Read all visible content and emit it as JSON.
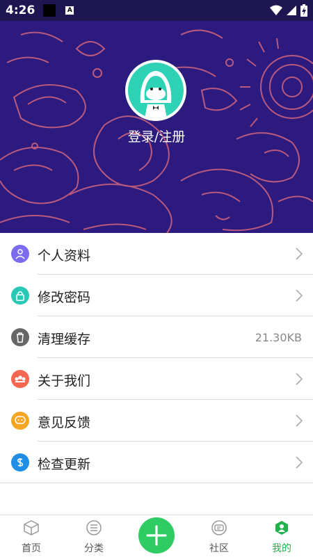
{
  "status_bar": {
    "time": "4:26",
    "notif_letter": "A"
  },
  "header": {
    "login_text": "登录/注册"
  },
  "menu": [
    {
      "label": "个人资料",
      "icon": "user-icon",
      "color": "#7b6cf0",
      "value": ""
    },
    {
      "label": "修改密码",
      "icon": "lock-icon",
      "color": "#29c9b5",
      "value": ""
    },
    {
      "label": "清理缓存",
      "icon": "trash-icon",
      "color": "#666666",
      "value": "21.30KB"
    },
    {
      "label": "关于我们",
      "icon": "group-icon",
      "color": "#f4664f",
      "value": ""
    },
    {
      "label": "意见反馈",
      "icon": "feedback-icon",
      "color": "#f5a623",
      "value": ""
    },
    {
      "label": "检查更新",
      "icon": "update-icon",
      "color": "#1e8ee6",
      "value": ""
    }
  ],
  "bottom_nav": {
    "home": "首页",
    "category": "分类",
    "community": "社区",
    "mine": "我的",
    "active_color": "#22b14c"
  }
}
